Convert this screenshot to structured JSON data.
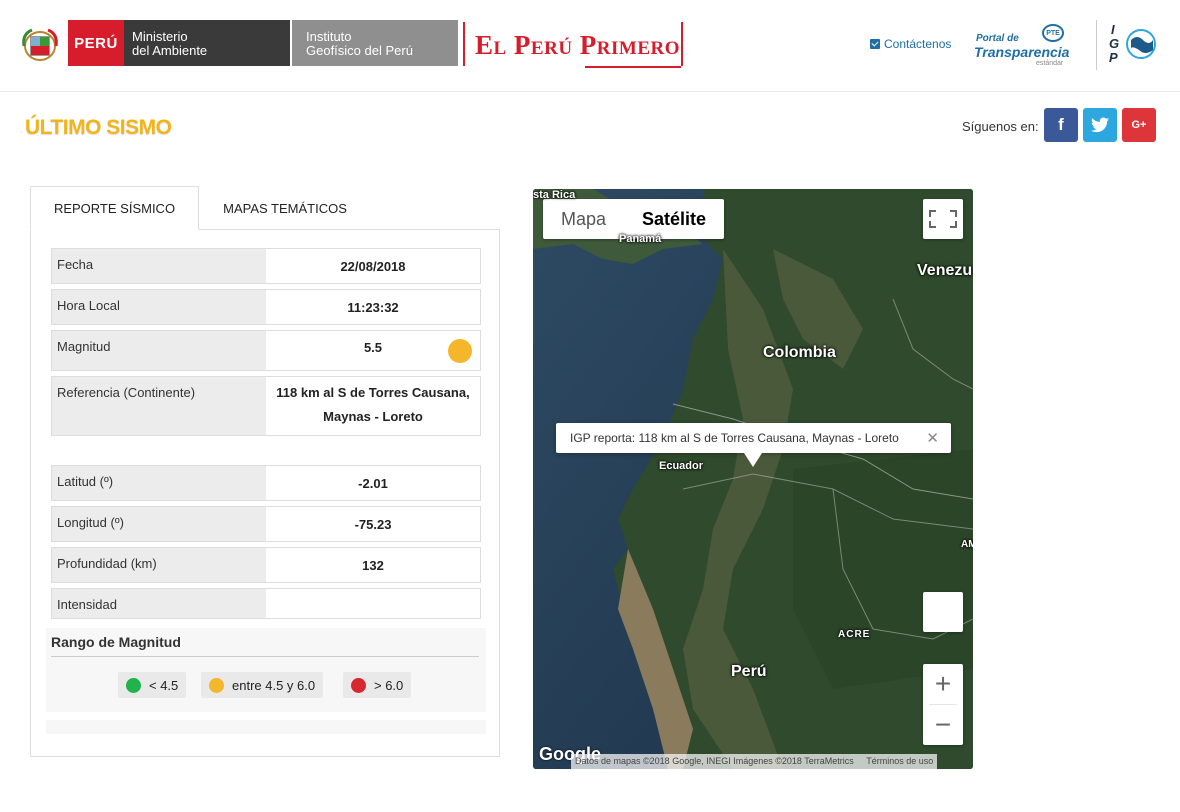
{
  "header": {
    "peru": "PERÚ",
    "ministry_line1": "Ministerio",
    "ministry_line2": "del Ambiente",
    "institute_line1": "Instituto",
    "institute_line2": "Geofísico del Perú",
    "slogan": "El Perú Primero",
    "contact": "Contáctenos",
    "transparency_small": "Portal de",
    "transparency_big": "Transparencia",
    "transparency_sub": "estándar",
    "pte": "PTE",
    "igp": [
      "I",
      "G",
      "P"
    ]
  },
  "title": "ÚLTIMO SISMO",
  "follow": {
    "label": "Síguenos en:",
    "facebook": "f",
    "twitter": "t",
    "googleplus": "G+"
  },
  "tabs": {
    "report": "REPORTE SÍSMICO",
    "maps": "MAPAS TEMÁTICOS"
  },
  "report": {
    "fecha": {
      "label": "Fecha",
      "value": "22/08/2018"
    },
    "hora": {
      "label": "Hora Local",
      "value": "11:23:32"
    },
    "magnitud": {
      "label": "Magnitud",
      "value": "5.5"
    },
    "referencia": {
      "label": "Referencia (Continente)",
      "value_line1": "118 km al S de Torres Causana,",
      "value_line2": "Maynas - Loreto"
    },
    "latitud": {
      "label": "Latitud (º)",
      "value": "-2.01"
    },
    "longitud": {
      "label": "Longitud (º)",
      "value": "-75.23"
    },
    "profundidad": {
      "label": "Profundidad (km)",
      "value": "132"
    },
    "intensidad": {
      "label": "Intensidad",
      "value": ""
    }
  },
  "range": {
    "title": "Rango de Magnitud",
    "items": [
      {
        "label": "< 4.5",
        "color": "#21b24a"
      },
      {
        "label": "entre 4.5 y 6.0",
        "color": "#f4b62a"
      },
      {
        "label": "> 6.0",
        "color": "#d7282f"
      }
    ]
  },
  "map": {
    "type_map": "Mapa",
    "type_satellite": "Satélite",
    "infowindow": "IGP reporta: 118 km al S de Torres Causana, Maynas - Loreto",
    "close": "✕",
    "labels": {
      "costa_rica": "sta Rica",
      "panama": "Panamá",
      "venezuela": "Venezu",
      "colombia": "Colombia",
      "ecuador": "Ecuador",
      "acre": "ACRE",
      "peru": "Perú",
      "am": "AM"
    },
    "zoom_in": "+",
    "zoom_out": "−",
    "google": "Google",
    "attribution": "Datos de mapas ©2018 Google, INEGI Imágenes ©2018 TerraMetrics",
    "terms": "Términos de uso"
  }
}
